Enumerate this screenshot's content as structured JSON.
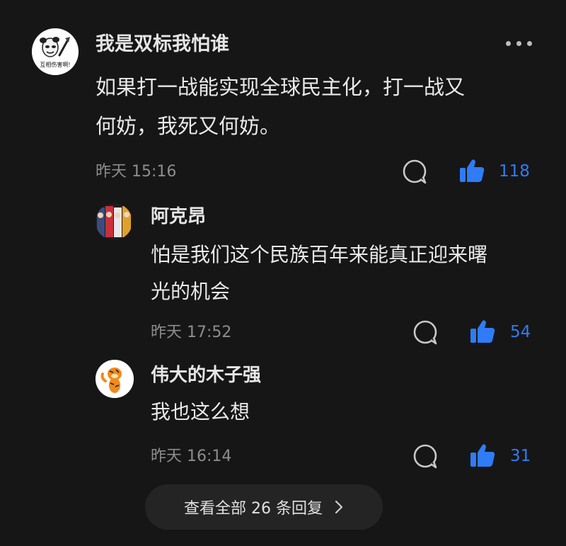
{
  "colors": {
    "background": "#161616",
    "accent": "#2f7cf6",
    "meta_text": "#8d8d8d",
    "pill": "#242424"
  },
  "main_comment": {
    "author": "我是双标我怕谁",
    "avatar_caption": "互相伤害啊!",
    "text_line1": "如果打一战能实现全球民主化，打一战又",
    "text_line2": "何妨，我死又何妨。",
    "time": "昨天 15:16",
    "likes": "118",
    "more_icon": "more-horizontal-icon",
    "reply_icon": "comment-bubble-icon",
    "like_icon": "thumbs-up-icon"
  },
  "replies": [
    {
      "author": "阿克昂",
      "text_line1": "怕是我们这个民族百年来能真正迎来曙",
      "text_line2": "光的机会",
      "time": "昨天 17:52",
      "likes": "54"
    },
    {
      "author": "伟大的木子强",
      "text_line1": "我也这么想",
      "time": "昨天 16:14",
      "likes": "31"
    }
  ],
  "view_all": {
    "label": "查看全部 26 条回复",
    "icon": "chevron-right-icon"
  }
}
